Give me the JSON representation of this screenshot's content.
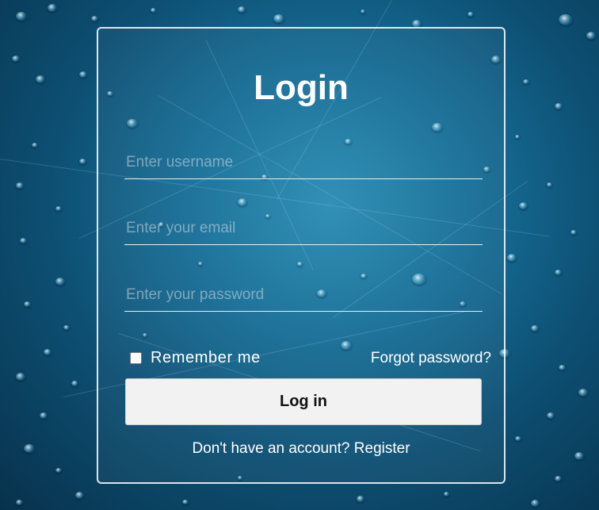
{
  "page": {
    "title": "Login"
  },
  "form": {
    "username_placeholder": "Enter username",
    "email_placeholder": "Enter your email",
    "password_placeholder": "Enter your password",
    "remember_label": "Remember me",
    "remember_checked": false,
    "forgot_label": "Forgot password?",
    "submit_label": "Log in",
    "register_prompt": "Don't have an account?",
    "register_link": "Register"
  },
  "colors": {
    "background": "#176f98",
    "text": "#ffffff",
    "button_bg": "#f2f2f2",
    "button_text": "#111111"
  }
}
